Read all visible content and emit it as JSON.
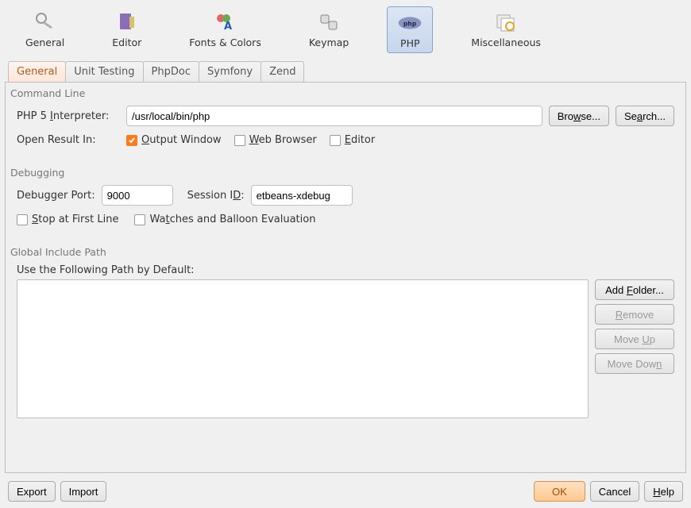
{
  "toolbar": {
    "items": [
      {
        "label": "General"
      },
      {
        "label": "Editor"
      },
      {
        "label": "Fonts & Colors"
      },
      {
        "label": "Keymap"
      },
      {
        "label": "PHP"
      },
      {
        "label": "Miscellaneous"
      }
    ]
  },
  "tabs": {
    "items": [
      {
        "label": "General"
      },
      {
        "label": "Unit Testing"
      },
      {
        "label": "PhpDoc"
      },
      {
        "label": "Symfony"
      },
      {
        "label": "Zend"
      }
    ]
  },
  "cmdline": {
    "title": "Command Line",
    "interp_label_pre": "PHP 5 ",
    "interp_label_u": "I",
    "interp_label_post": "nterpreter:",
    "interp_value": "/usr/local/bin/php",
    "browse_pre": "Bro",
    "browse_u": "w",
    "browse_post": "se...",
    "search_pre": "Se",
    "search_u": "a",
    "search_post": "rch...",
    "open_label": "Open Result In:",
    "out_u": "O",
    "out_post": "utput Window",
    "web_pre": "",
    "web_u": "W",
    "web_post": "eb Browser",
    "ed_pre": "",
    "ed_u": "E",
    "ed_post": "ditor"
  },
  "debug": {
    "title": "Debugging",
    "port_label": "Debugger Port:",
    "port_value": "9000",
    "sess_label_pre": "Session I",
    "sess_label_u": "D",
    "sess_label_post": ":",
    "sess_value": "etbeans-xdebug",
    "stop_pre": "",
    "stop_u": "S",
    "stop_post": "top at First Line",
    "watch_pre": "Wa",
    "watch_u": "t",
    "watch_post": "ches and Balloon Evaluation"
  },
  "include": {
    "title": "Global Include Path",
    "subtitle": "Use the Following Path by Default:",
    "add_pre": "Add ",
    "add_u": "F",
    "add_post": "older...",
    "remove_u": "R",
    "remove_post": "emove",
    "up_pre": "Move ",
    "up_u": "U",
    "up_post": "p",
    "dn_pre": "Move Dow",
    "dn_u": "n"
  },
  "bottom": {
    "export": "Export",
    "import": "Import",
    "ok": "OK",
    "cancel": "Cancel",
    "help_u": "H",
    "help_post": "elp"
  }
}
